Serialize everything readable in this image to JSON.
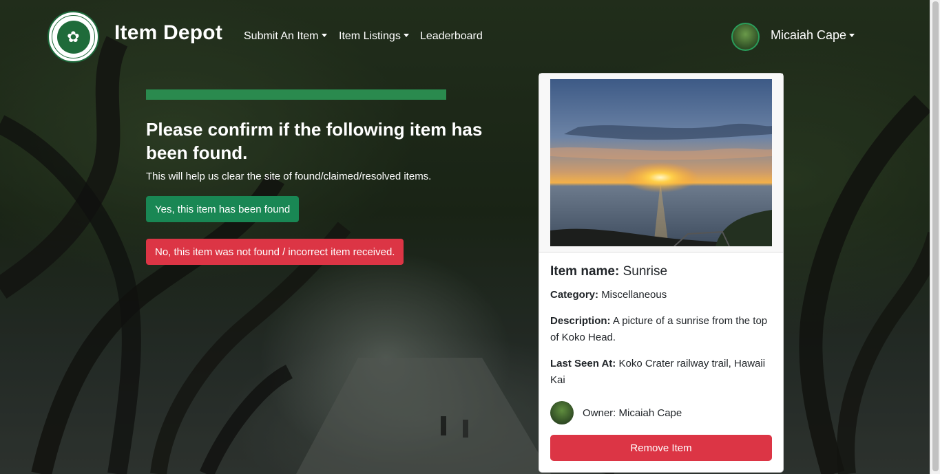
{
  "navbar": {
    "brand": "Item Depot",
    "logo_icon": "university-seal-icon",
    "links": [
      {
        "label": "Submit An Item",
        "dropdown": true
      },
      {
        "label": "Item Listings",
        "dropdown": true
      },
      {
        "label": "Leaderboard",
        "dropdown": false
      }
    ],
    "user": {
      "name": "Micaiah Cape",
      "dropdown": true
    }
  },
  "confirm": {
    "title": "Please confirm if the following item has been found.",
    "subtitle": "This will help us clear the site of found/claimed/resolved items.",
    "found_button": "Yes, this item has been found",
    "not_found_button": "No, this item was not found / incorrect item received."
  },
  "item": {
    "name_label": "Item name:",
    "name": "Sunrise",
    "category_label": "Category:",
    "category": "Miscellaneous",
    "description_label": "Description:",
    "description": "A picture of a sunrise from the top of Koko Head.",
    "last_seen_label": "Last Seen At:",
    "last_seen": "Koko Crater railway trail, Hawaii Kai",
    "owner_text": "Owner: Micaiah Cape",
    "remove_button": "Remove Item"
  },
  "colors": {
    "success": "#198754",
    "danger": "#dc3545",
    "progress": "#2a8a4e"
  }
}
